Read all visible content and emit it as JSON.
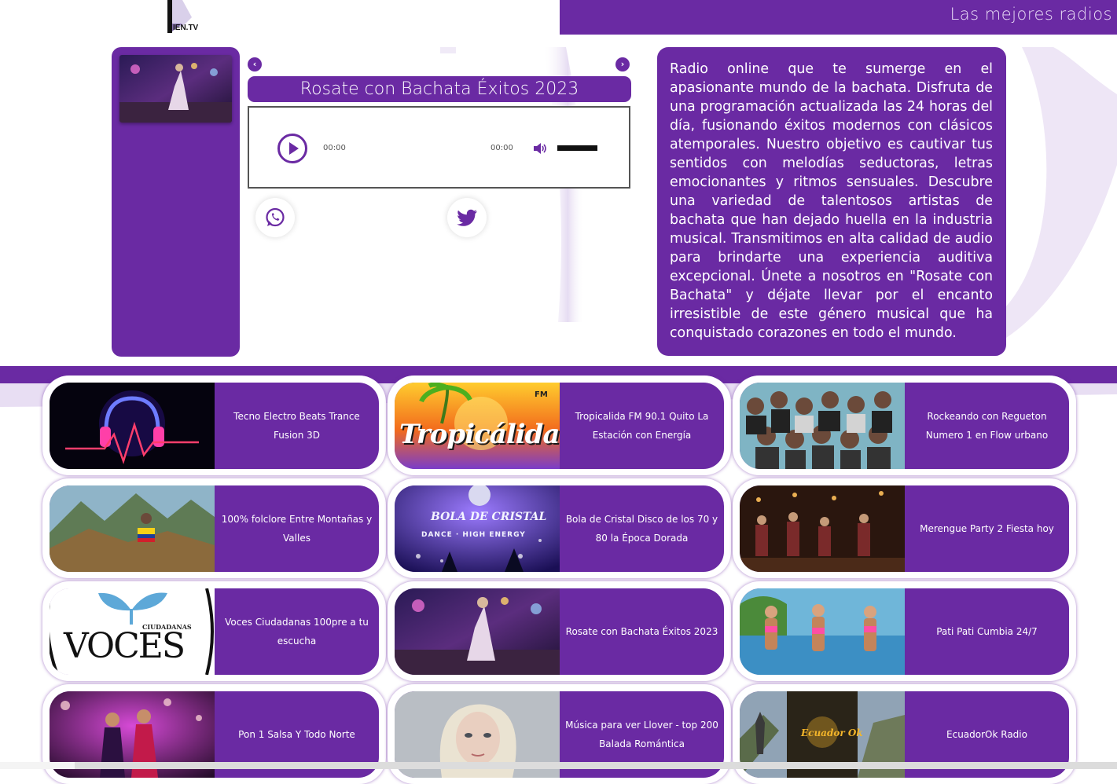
{
  "header": {
    "logo_text": "IEN.TV",
    "tagline": "Las mejores radios"
  },
  "player": {
    "prev_symbol": "‹",
    "next_symbol": "›",
    "station_title": "Rosate con Bachata Éxitos 2023",
    "current_time": "00:00",
    "duration": "00:00"
  },
  "description": "Radio online que te sumerge en el apasionante mundo de la bachata. Disfruta de una programación actualizada las 24 horas del día, fusionando éxitos modernos con clásicos atemporales. Nuestro objetivo es cautivar tus sentidos con melodías seductoras, letras emocionantes y ritmos sensuales. Descubre una variedad de talentosos artistas de bachata que han dejado huella en la industria musical. Transmitimos en alta calidad de audio para brindarte una experiencia auditiva excepcional. Únete a nosotros en \"Rosate con Bachata\" y déjate llevar por el encanto irresistible de este género musical que ha conquistado corazones en todo el mundo.",
  "colors": {
    "brand_purple": "#6a2aa3"
  },
  "stations": [
    {
      "name": "Tecno Electro Beats Trance Fusion 3D"
    },
    {
      "name": "Tropicalida FM 90.1 Quito La Estación con Energía",
      "logo_text": "Tropicálida",
      "logo_badge": "FM"
    },
    {
      "name": "Rockeando con Regueton Numero 1 en Flow urbano"
    },
    {
      "name": "100% folclore Entre Montañas y Valles"
    },
    {
      "name": "Bola de Cristal Disco de los 70 y 80 la Época Dorada",
      "logo_text": "BOLA DE CRISTAL",
      "logo_sub": "DANCE · HIGH ENERGY"
    },
    {
      "name": "Merengue Party 2 Fiesta hoy"
    },
    {
      "name": "Voces Ciudadanas 100pre a tu escucha",
      "logo_text": "VOCES",
      "logo_sub": "CIUDADANAS"
    },
    {
      "name": "Rosate con Bachata Éxitos 2023"
    },
    {
      "name": "Pati Pati Cumbia 24/7"
    },
    {
      "name": "Pon 1 Salsa Y Todo Norte"
    },
    {
      "name": "Música para ver Llover - top 200 Balada Romántica"
    },
    {
      "name": "EcuadorOk Radio",
      "logo_text": "Ecuador Ok"
    }
  ]
}
